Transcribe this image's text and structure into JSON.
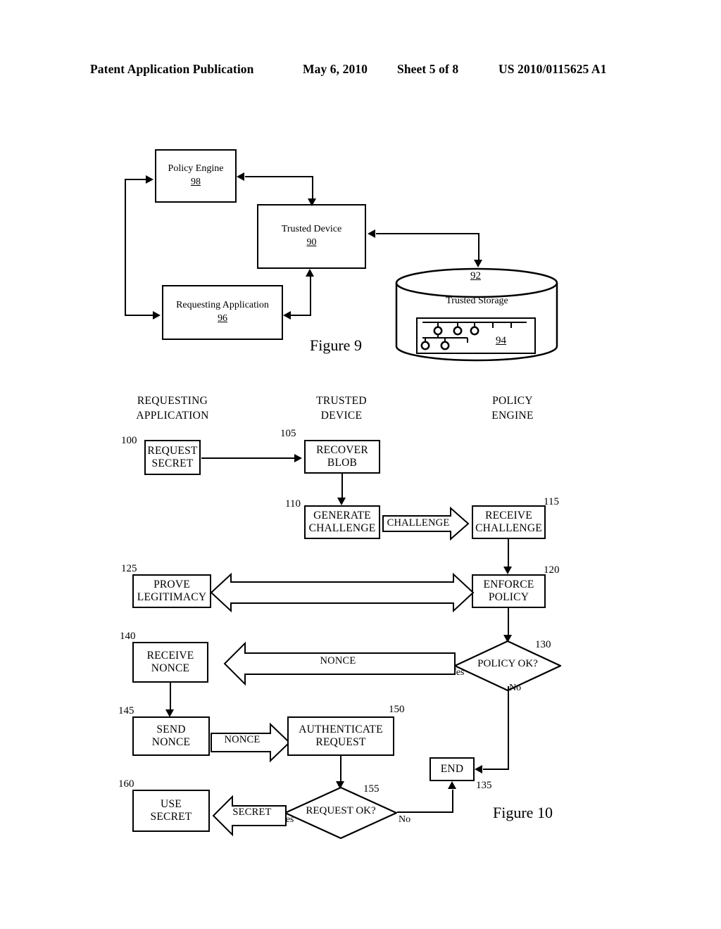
{
  "header": {
    "publication": "Patent Application Publication",
    "date": "May 6, 2010",
    "sheet": "Sheet 5 of 8",
    "number": "US 2010/0115625 A1"
  },
  "figure9": {
    "caption": "Figure 9",
    "blocks": [
      {
        "id": "policy-engine",
        "label": "Policy Engine",
        "num": "98"
      },
      {
        "id": "trusted-device",
        "label": "Trusted Device",
        "num": "90"
      },
      {
        "id": "requesting-application",
        "label": "Requesting Application",
        "num": "96"
      }
    ],
    "storage": {
      "label": "Trusted Storage",
      "num_top": "92",
      "num_inner": "94"
    }
  },
  "figure10": {
    "caption": "Figure 10",
    "columns": [
      {
        "id": "col-requesting-application",
        "line1": "REQUESTING",
        "line2": "APPLICATION"
      },
      {
        "id": "col-trusted-device",
        "line1": "TRUSTED",
        "line2": "DEVICE"
      },
      {
        "id": "col-policy-engine",
        "line1": "POLICY",
        "line2": "ENGINE"
      }
    ],
    "steps": [
      {
        "id": "request-secret",
        "line1": "REQUEST",
        "line2": "SECRET",
        "ref": "100"
      },
      {
        "id": "recover-blob",
        "line1": "RECOVER",
        "line2": "BLOB",
        "ref": "105"
      },
      {
        "id": "generate-challenge",
        "line1": "GENERATE",
        "line2": "CHALLENGE",
        "ref": "110"
      },
      {
        "id": "receive-challenge",
        "line1": "RECEIVE",
        "line2": "CHALLENGE",
        "ref": "115"
      },
      {
        "id": "enforce-policy",
        "line1": "ENFORCE",
        "line2": "POLICY",
        "ref": "120"
      },
      {
        "id": "prove-legitimacy",
        "line1": "PROVE",
        "line2": "LEGITIMACY",
        "ref": "125"
      },
      {
        "id": "receive-nonce",
        "line1": "RECEIVE",
        "line2": "NONCE",
        "ref": "140"
      },
      {
        "id": "send-nonce",
        "line1": "SEND",
        "line2": "NONCE",
        "ref": "145"
      },
      {
        "id": "authenticate-request",
        "line1": "AUTHENTICATE",
        "line2": "REQUEST",
        "ref": "150"
      },
      {
        "id": "use-secret",
        "line1": "USE",
        "line2": "SECRET",
        "ref": "160"
      },
      {
        "id": "end",
        "line1": "END",
        "line2": "",
        "ref": "135"
      }
    ],
    "decisions": [
      {
        "id": "policy-ok",
        "label": "POLICY OK?",
        "ref": "130",
        "yes": "Yes",
        "no": "No"
      },
      {
        "id": "request-ok",
        "label": "REQUEST OK?",
        "ref": "155",
        "yes": "Yes",
        "no": "No"
      }
    ],
    "messages": [
      {
        "id": "msg-challenge",
        "label": "CHALLENGE"
      },
      {
        "id": "msg-nonce-down",
        "label": "NONCE"
      },
      {
        "id": "msg-nonce-up",
        "label": "NONCE"
      },
      {
        "id": "msg-secret",
        "label": "SECRET"
      }
    ]
  }
}
